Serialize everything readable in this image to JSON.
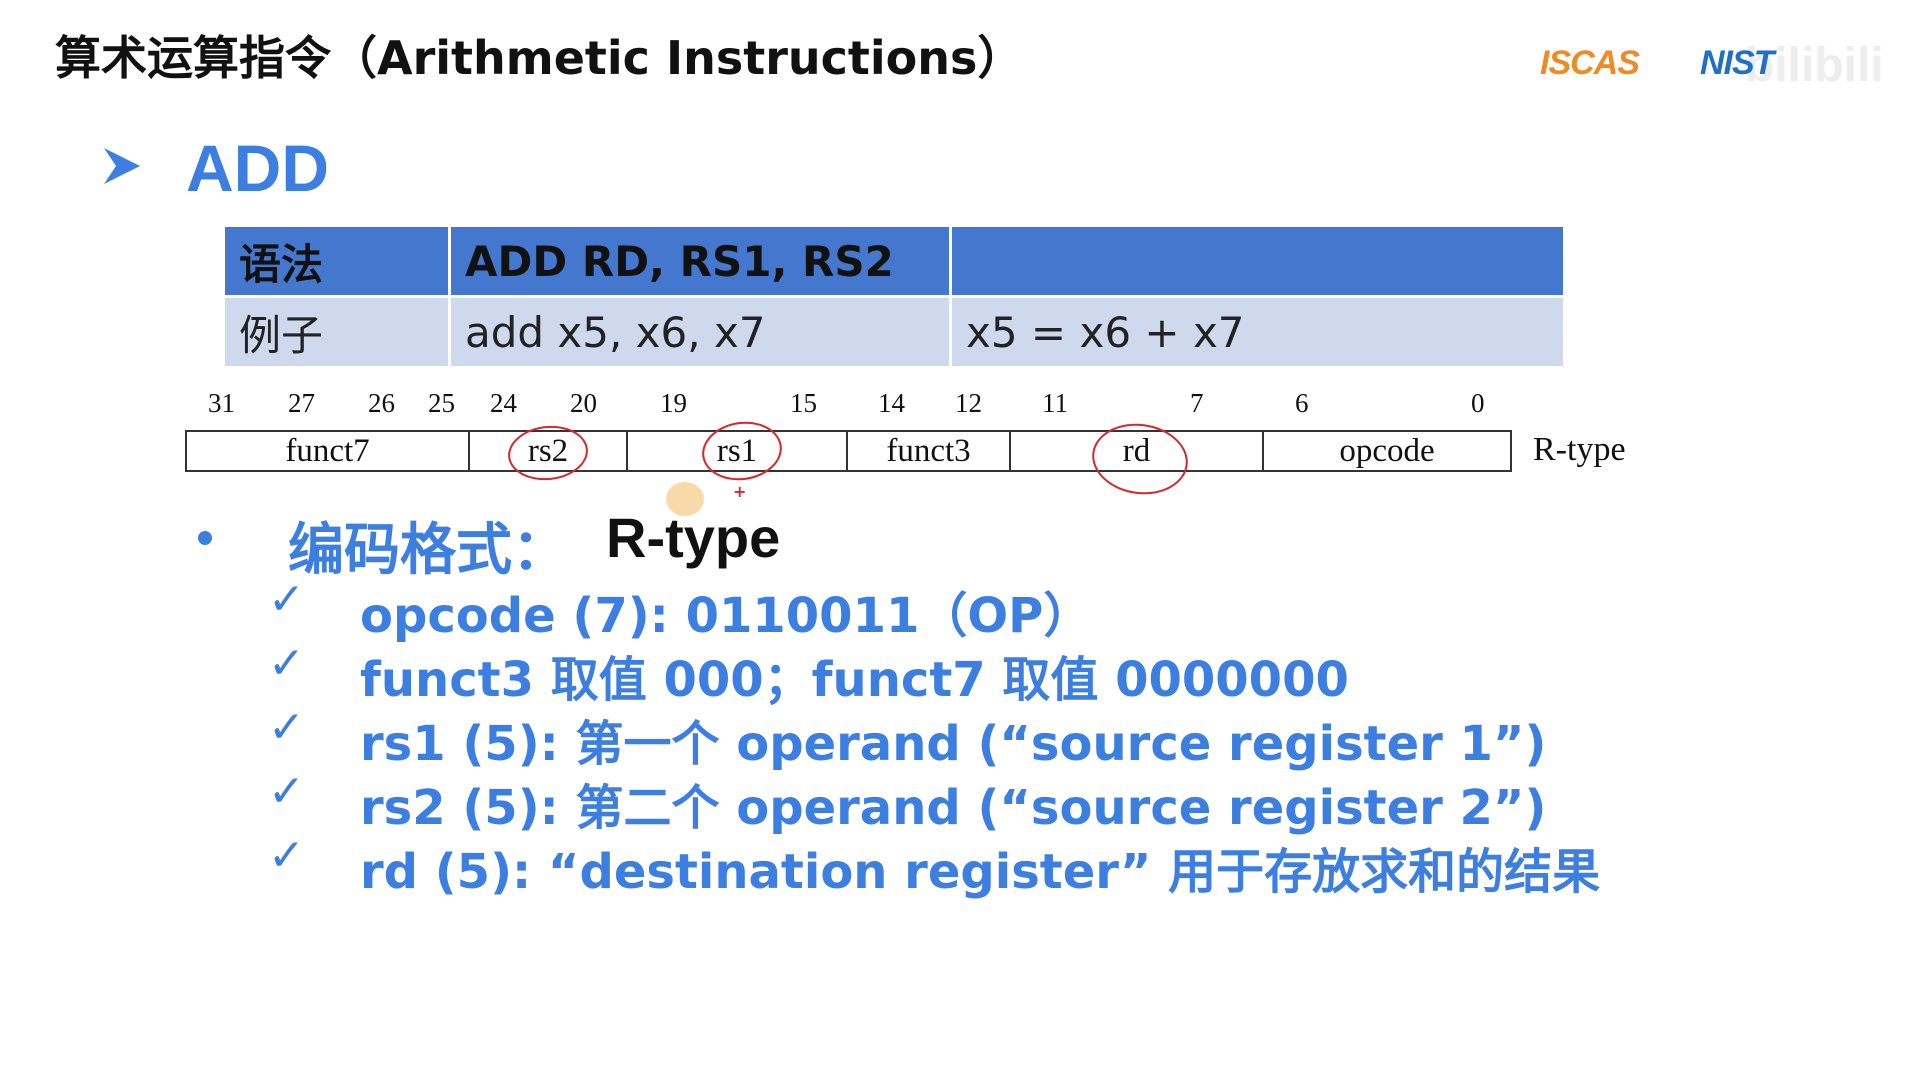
{
  "header": {
    "title": "算术运算指令（Arithmetic Instructions）",
    "logos": {
      "iscas": "ISCAS",
      "nist": "NIST",
      "watermark": "bilibili"
    }
  },
  "section": {
    "arrow_icon": "arrow-right-icon",
    "title": "ADD"
  },
  "syntax_table": {
    "rows": [
      {
        "label": "语法",
        "code": "ADD RD, RS1, RS2",
        "note": ""
      },
      {
        "label": "例子",
        "code": "add x5, x6, x7",
        "note": "x5 = x6 + x7"
      }
    ]
  },
  "encoding_diagram": {
    "bit_labels": [
      "31",
      "27",
      "26",
      "25",
      "24",
      "20",
      "19",
      "15",
      "14",
      "12",
      "11",
      "7",
      "6",
      "0"
    ],
    "fields": [
      "funct7",
      "rs2",
      "rs1",
      "funct3",
      "rd",
      "opcode"
    ],
    "type_label": "R-type",
    "annotation_mark": "+"
  },
  "bullet": {
    "label": "编码格式：",
    "value": "R-type"
  },
  "checklist": [
    "opcode (7): 0110011（OP）",
    "funct3 取值 000；funct7 取值 0000000",
    "rs1 (5): 第一个 operand (“source register 1”)",
    "rs2 (5): 第二个 operand (“source register 2”)",
    "rd (5): “destination register” 用于存放求和的结果"
  ],
  "colors": {
    "accent": "#3d7fe0",
    "table_header": "#4478cf",
    "table_row": "#cfd9ee",
    "annotation": "#d7262c"
  }
}
